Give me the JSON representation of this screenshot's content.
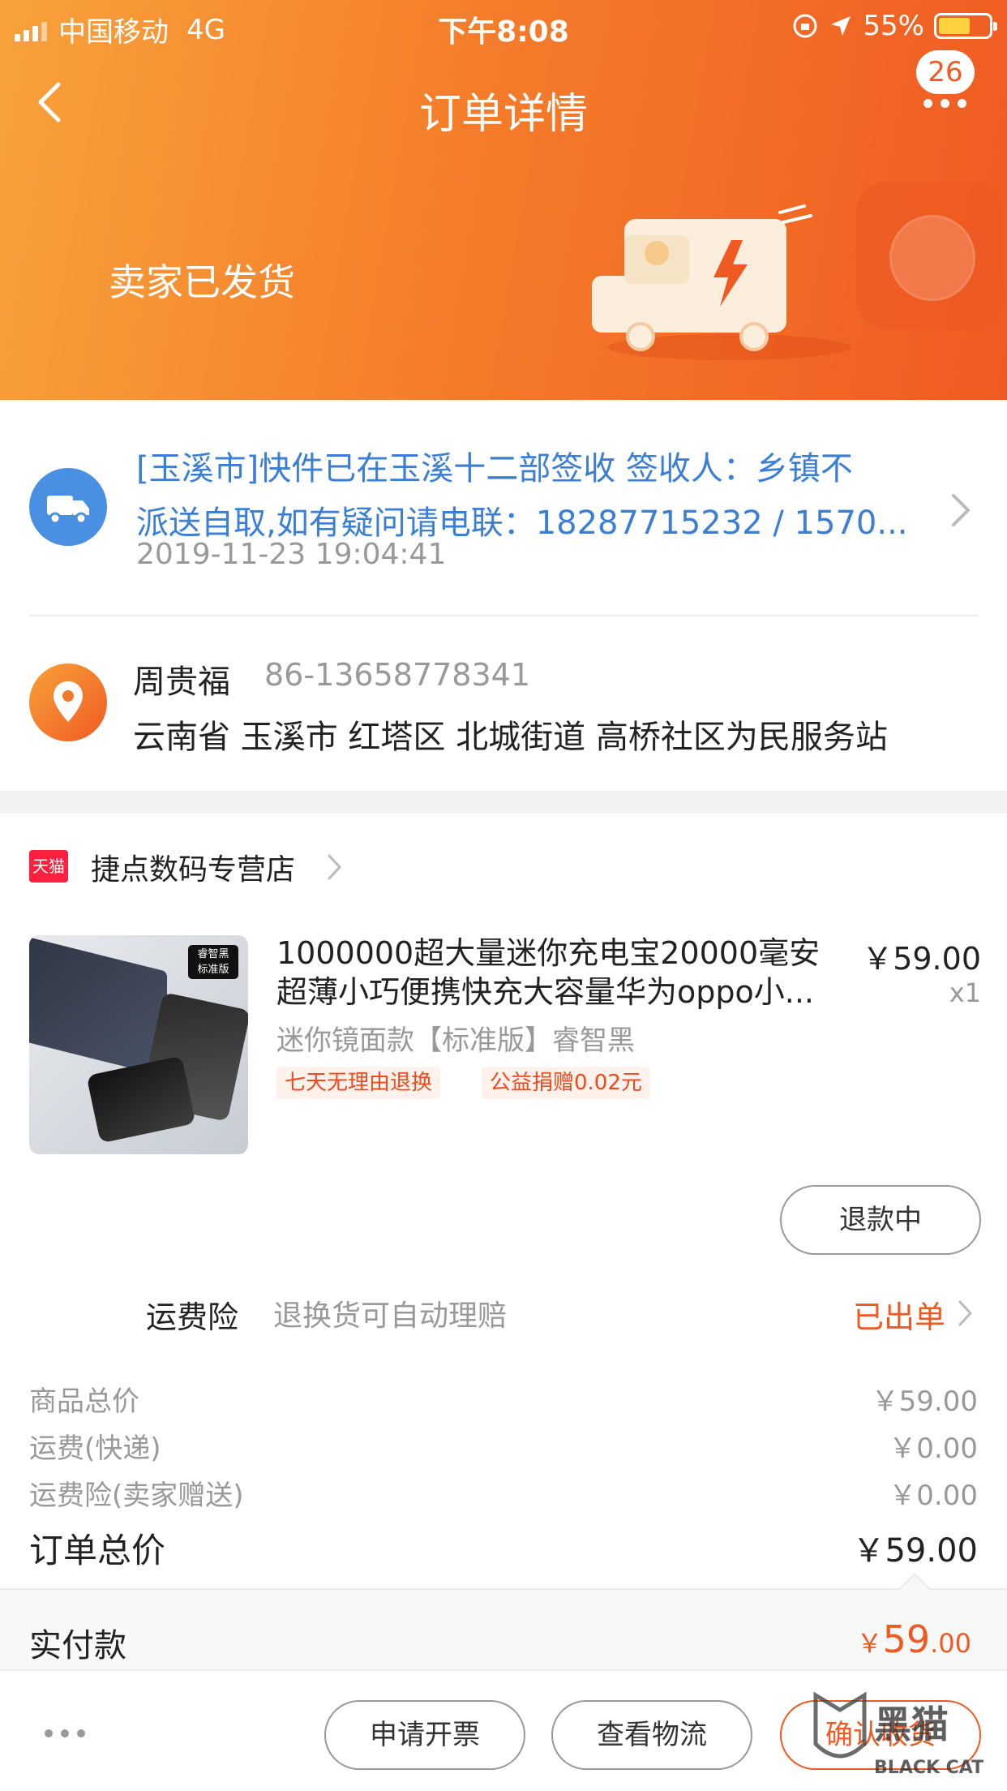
{
  "status_bar": {
    "carrier": "中国移动",
    "network": "4G",
    "time": "下午8:08",
    "battery": "55%"
  },
  "nav": {
    "title": "订单详情",
    "badge": "26"
  },
  "order_status": "卖家已发货",
  "logistics": {
    "line1": "[玉溪市]快件已在玉溪十二部签收 签收人：乡镇不",
    "line2": "派送自取,如有疑问请电联：18287715232 / 1570...",
    "time": "2019-11-23 19:04:41"
  },
  "address": {
    "name": "周贵福",
    "phone": "86-13658778341",
    "detail": "云南省 玉溪市 红塔区 北城街道 高桥社区为民服务站"
  },
  "shop": {
    "badge": "天猫",
    "name": "捷点数码专营店"
  },
  "product": {
    "thumb_tag1": "睿智黑",
    "thumb_tag2": "标准版",
    "title_line1": "1000000超大量迷你充电宝20000毫安",
    "title_line2": "超薄小巧便携快充大容量华为oppo小...",
    "price": "￥59.00",
    "qty": "x1",
    "sku": "迷你镜面款【标准版】睿智黑",
    "tags": [
      "七天无理由退换",
      "公益捐赠0.02元"
    ],
    "refund_label": "退款中"
  },
  "insurance": {
    "label": "运费险",
    "desc": "退换货可自动理赔",
    "status": "已出单"
  },
  "fees": [
    {
      "label": "商品总价",
      "value": "￥59.00"
    },
    {
      "label": "运费(快递)",
      "value": "￥0.00"
    },
    {
      "label": "运费险(卖家赠送)",
      "value": "￥0.00"
    }
  ],
  "total": {
    "label": "订单总价",
    "value": "￥59.00"
  },
  "paid": {
    "label": "实付款",
    "currency": "￥",
    "integer": "59",
    "decimal": ".00"
  },
  "actions": {
    "invoice": "申请开票",
    "logistics": "查看物流",
    "confirm": "确认收货"
  },
  "watermark": {
    "text": "黑猫",
    "sub": "BLACK CAT"
  },
  "colors": {
    "accent": "#f05a22",
    "link_blue": "#3a7fd5",
    "header_start": "#f8a23b",
    "header_end": "#f05a22"
  }
}
